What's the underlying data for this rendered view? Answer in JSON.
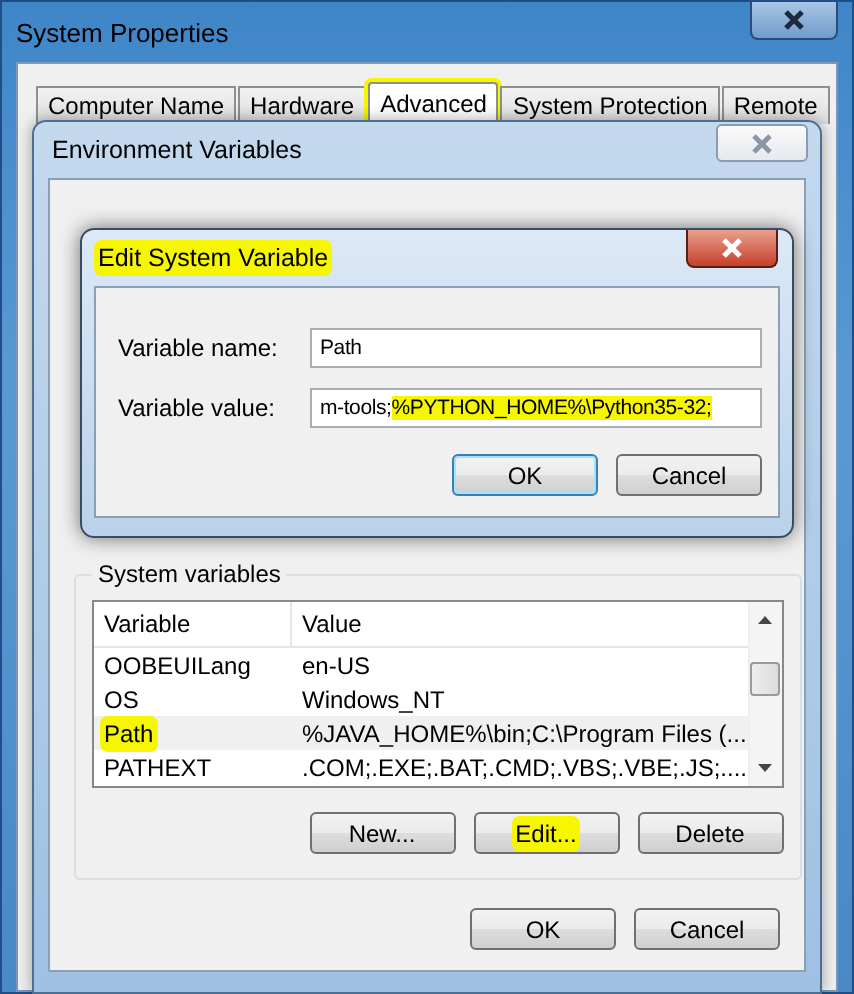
{
  "system_properties": {
    "title": "System Properties",
    "tabs": [
      {
        "label": "Computer Name",
        "selected": false,
        "highlighted": false
      },
      {
        "label": "Hardware",
        "selected": false,
        "highlighted": false
      },
      {
        "label": "Advanced",
        "selected": true,
        "highlighted": true
      },
      {
        "label": "System Protection",
        "selected": false,
        "highlighted": false
      },
      {
        "label": "Remote",
        "selected": false,
        "highlighted": false
      }
    ]
  },
  "environment_variables": {
    "title": "Environment Variables",
    "system_variables": {
      "title": "System variables",
      "columns": [
        "Variable",
        "Value"
      ],
      "rows": [
        {
          "variable": "OOBEUILang",
          "value": "en-US",
          "selected": false,
          "highlighted": false
        },
        {
          "variable": "OS",
          "value": "Windows_NT",
          "selected": false,
          "highlighted": false
        },
        {
          "variable": "Path",
          "value": "%JAVA_HOME%\\bin;C:\\Program Files (...",
          "selected": true,
          "highlighted": true
        },
        {
          "variable": "PATHEXT",
          "value": ".COM;.EXE;.BAT;.CMD;.VBS;.VBE;.JS;....",
          "selected": false,
          "highlighted": false
        }
      ],
      "buttons": [
        {
          "label": "New...",
          "highlighted": false
        },
        {
          "label": "Edit...",
          "highlighted": true
        },
        {
          "label": "Delete",
          "highlighted": false
        }
      ]
    },
    "buttons": [
      {
        "label": "OK"
      },
      {
        "label": "Cancel"
      }
    ]
  },
  "edit_dialog": {
    "title": "Edit System Variable",
    "title_highlighted": true,
    "fields": [
      {
        "label": "Variable name:",
        "segments": [
          {
            "text": "Path",
            "highlighted": false
          }
        ]
      },
      {
        "label": "Variable value:",
        "segments": [
          {
            "text": "m-tools;",
            "highlighted": false
          },
          {
            "text": "%PYTHON_HOME%\\Python35-32;",
            "highlighted": true
          }
        ]
      }
    ],
    "buttons": [
      {
        "label": "OK",
        "default": true
      },
      {
        "label": "Cancel",
        "default": false
      }
    ]
  }
}
